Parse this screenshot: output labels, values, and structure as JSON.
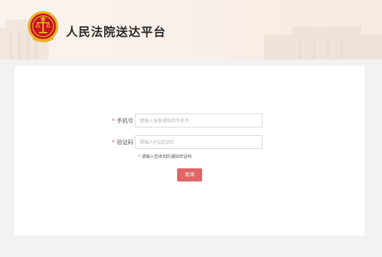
{
  "header": {
    "title": "人民法院送达平台",
    "emblem_icon": "court-emblem-icon"
  },
  "form": {
    "phone": {
      "required_mark": "*",
      "label": "手机号",
      "placeholder": "请输入接收通知的手机号",
      "value": ""
    },
    "code": {
      "required_mark": "*",
      "label": "验证码",
      "placeholder": "请输入6位验证码",
      "value": ""
    },
    "hint": {
      "mark": "*",
      "text": "请输入您收到的通知验证码"
    },
    "submit_label": "查询"
  },
  "colors": {
    "accent": "#e16565",
    "required": "#d9534f",
    "emblem_red": "#c8161d",
    "emblem_gold": "#e8b429"
  }
}
